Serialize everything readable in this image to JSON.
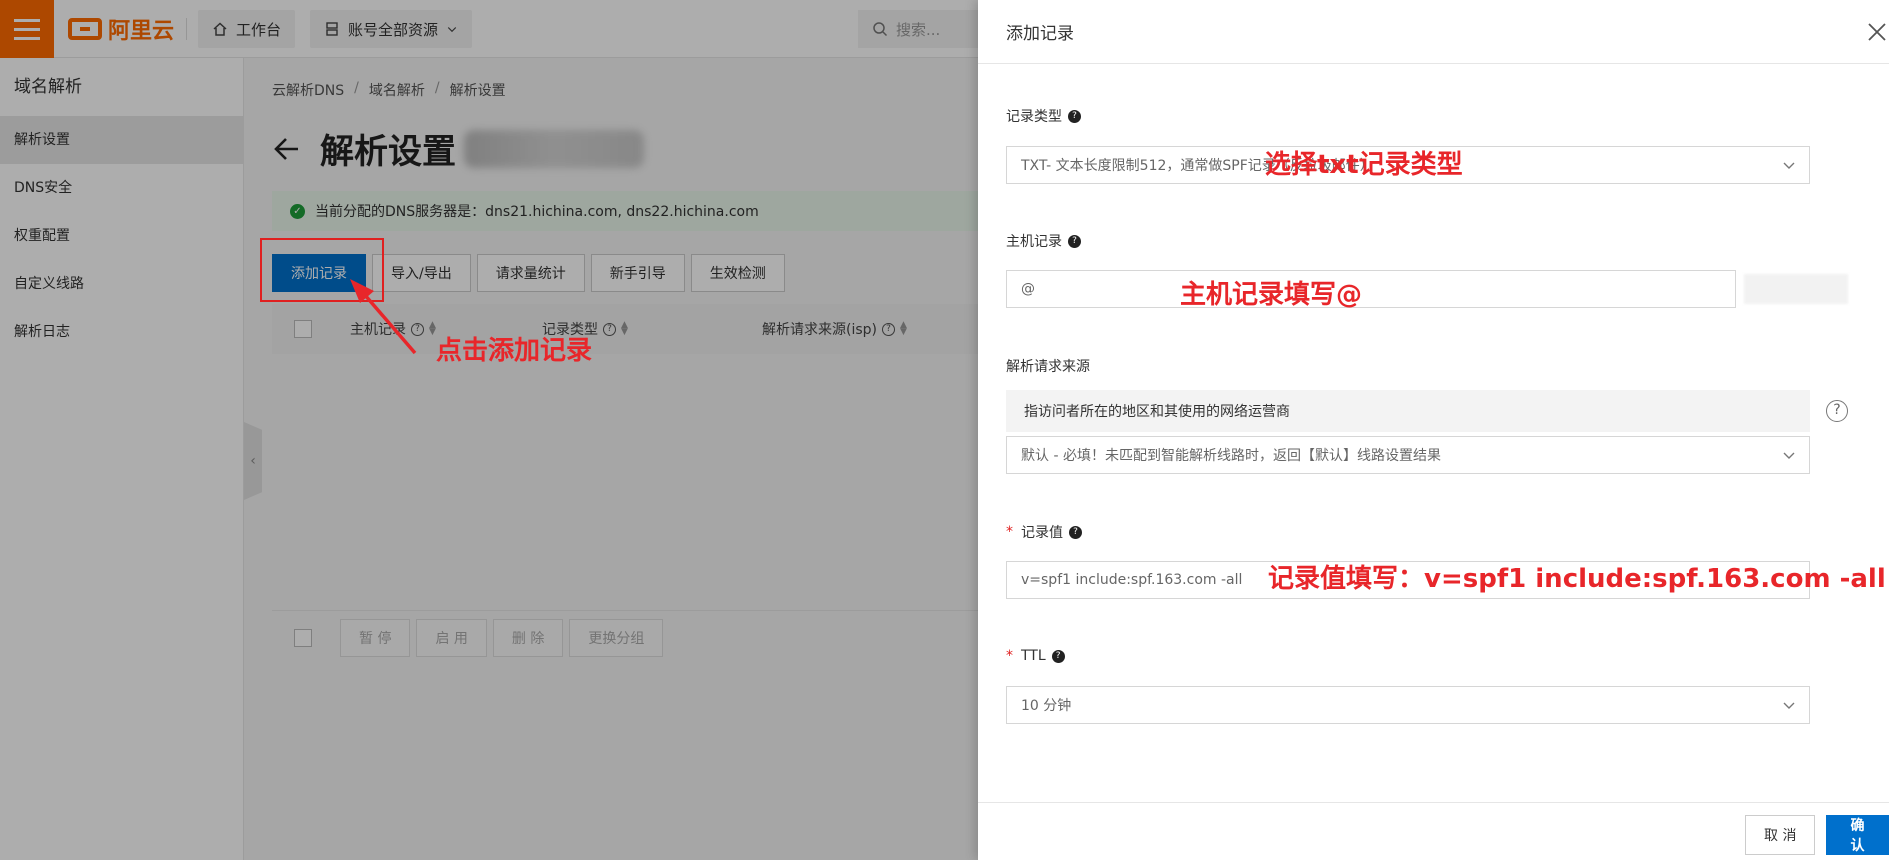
{
  "app": {
    "logo_text": "阿里云",
    "nav_workbench": "工作台",
    "nav_resources": "账号全部资源",
    "search_placeholder": "搜索..."
  },
  "sidebar": {
    "title": "域名解析",
    "items": [
      {
        "label": "解析设置",
        "active": true
      },
      {
        "label": "DNS安全"
      },
      {
        "label": "权重配置"
      },
      {
        "label": "自定义线路"
      },
      {
        "label": "解析日志"
      }
    ]
  },
  "main": {
    "breadcrumb": [
      "云解析DNS",
      "域名解析",
      "解析设置"
    ],
    "page_title": "解析设置",
    "dns_notice": "当前分配的DNS服务器是：dns21.hichina.com, dns22.hichina.com",
    "toolbar": {
      "add": "添加记录",
      "import_export": "导入/导出",
      "stats": "请求量统计",
      "guide": "新手引导",
      "check": "生效检测"
    },
    "table_headers": [
      "主机记录",
      "记录类型",
      "解析请求来源(isp)"
    ],
    "footer_buttons": [
      "暂 停",
      "启 用",
      "删 除",
      "更换分组"
    ]
  },
  "drawer": {
    "title": "添加记录",
    "record_type": {
      "label": "记录类型",
      "value": "TXT- 文本长度限制512，通常做SPF记录（反垃圾邮件）"
    },
    "host": {
      "label": "主机记录",
      "value": "@"
    },
    "source": {
      "label": "解析请求来源",
      "info": "指访问者所在的地区和其使用的网络运营商",
      "placeholder": "默认 - 必填！未匹配到智能解析线路时，返回【默认】线路设置结果"
    },
    "record_value": {
      "label": "记录值",
      "value": "v=spf1 include:spf.163.com -all"
    },
    "ttl": {
      "label": "TTL",
      "value": "10 分钟"
    },
    "cancel": "取 消",
    "confirm": "确 认"
  },
  "annotations": {
    "click_add": "点击添加记录",
    "select_txt": "选择txt记录类型",
    "host_fill": "主机记录填写@",
    "value_fill": "记录值填写：v=spf1 include:spf.163.com -all"
  },
  "colors": {
    "brand": "#ff6a00",
    "primary": "#0070cc",
    "annotation": "#e8262a",
    "success": "#1e9e3a"
  }
}
